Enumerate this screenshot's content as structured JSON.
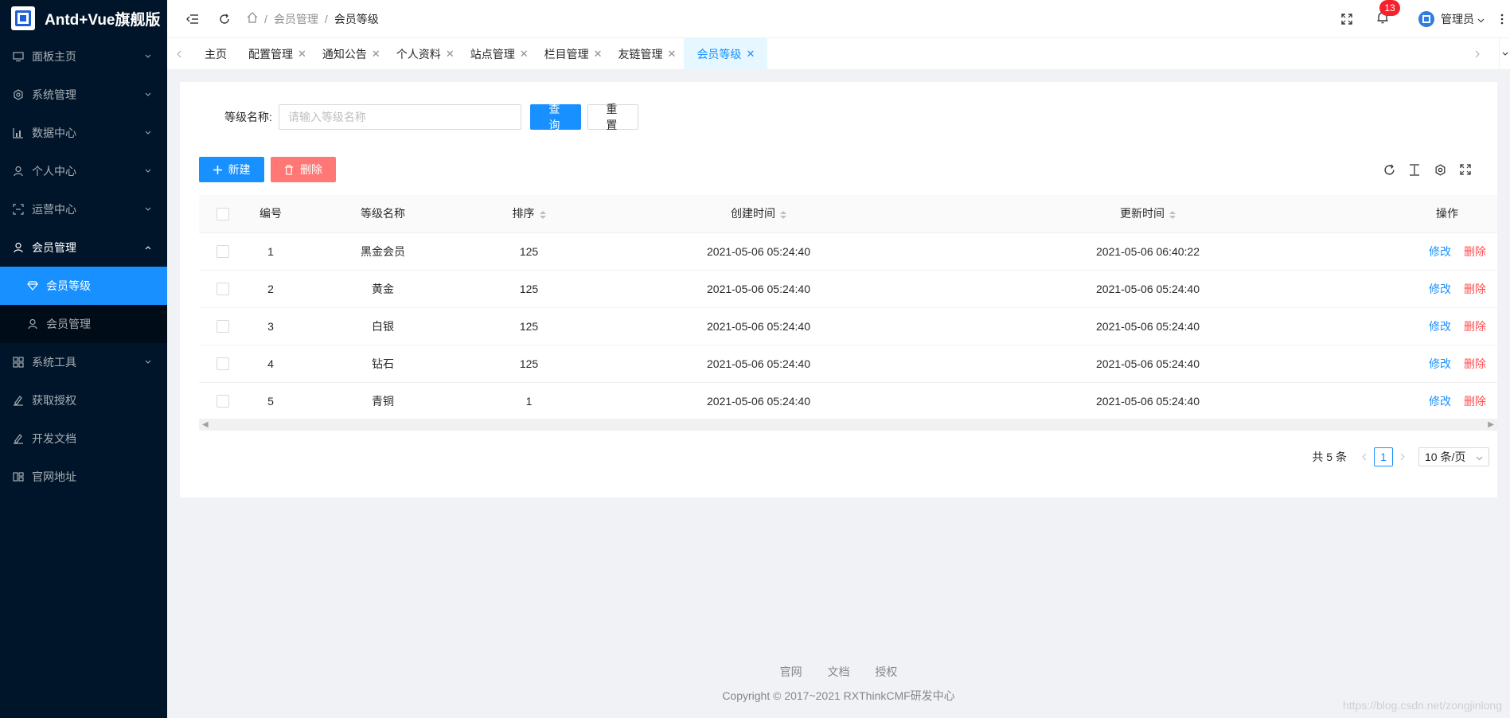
{
  "app": {
    "title": "Antd+Vue旗舰版"
  },
  "sidebar": {
    "items": [
      {
        "label": "面板主页",
        "icon": "monitor-icon"
      },
      {
        "label": "系统管理",
        "icon": "settings-icon"
      },
      {
        "label": "数据中心",
        "icon": "chart-icon"
      },
      {
        "label": "个人中心",
        "icon": "user-icon"
      },
      {
        "label": "运营中心",
        "icon": "scan-icon"
      },
      {
        "label": "会员管理",
        "icon": "user-icon"
      },
      {
        "label": "系统工具",
        "icon": "tool-icon"
      },
      {
        "label": "获取授权",
        "icon": "edit-icon"
      },
      {
        "label": "开发文档",
        "icon": "edit-icon"
      },
      {
        "label": "官网地址",
        "icon": "layout-icon"
      }
    ],
    "submenu": [
      {
        "label": "会员等级",
        "icon": "diamond-icon"
      },
      {
        "label": "会员管理",
        "icon": "user-icon"
      }
    ]
  },
  "header": {
    "breadcrumb": [
      "会员管理",
      "会员等级"
    ],
    "notification_count": "13",
    "user_name": "管理员"
  },
  "tabs": [
    {
      "label": "主页"
    },
    {
      "label": "配置管理"
    },
    {
      "label": "通知公告"
    },
    {
      "label": "个人资料"
    },
    {
      "label": "站点管理"
    },
    {
      "label": "栏目管理"
    },
    {
      "label": "友链管理"
    },
    {
      "label": "会员等级"
    }
  ],
  "search": {
    "label": "等级名称:",
    "placeholder": "请输入等级名称",
    "query_label": "查询",
    "reset_label": "重置"
  },
  "toolbar": {
    "new_label": "新建",
    "delete_label": "删除"
  },
  "table": {
    "columns": {
      "id": "编号",
      "name": "等级名称",
      "sort": "排序",
      "created": "创建时间",
      "updated": "更新时间",
      "actions": "操作"
    },
    "edit_label": "修改",
    "delete_label": "删除",
    "rows": [
      {
        "id": "1",
        "name": "黑金会员",
        "sort": "125",
        "created": "2021-05-06 05:24:40",
        "updated": "2021-05-06 06:40:22"
      },
      {
        "id": "2",
        "name": "黄金",
        "sort": "125",
        "created": "2021-05-06 05:24:40",
        "updated": "2021-05-06 05:24:40"
      },
      {
        "id": "3",
        "name": "白银",
        "sort": "125",
        "created": "2021-05-06 05:24:40",
        "updated": "2021-05-06 05:24:40"
      },
      {
        "id": "4",
        "name": "钻石",
        "sort": "125",
        "created": "2021-05-06 05:24:40",
        "updated": "2021-05-06 05:24:40"
      },
      {
        "id": "5",
        "name": "青铜",
        "sort": "1",
        "created": "2021-05-06 05:24:40",
        "updated": "2021-05-06 05:24:40"
      }
    ]
  },
  "pagination": {
    "total": "共 5 条",
    "current": "1",
    "page_size": "10 条/页"
  },
  "footer": {
    "links": [
      "官网",
      "文档",
      "授权"
    ],
    "copyright": "Copyright © 2017~2021 RXThinkCMF研发中心"
  },
  "watermark": "https://blog.csdn.net/zongjinlong",
  "colors": {
    "primary": "#1890ff",
    "sidebar_bg": "#001529",
    "danger": "#ff4d4f"
  }
}
